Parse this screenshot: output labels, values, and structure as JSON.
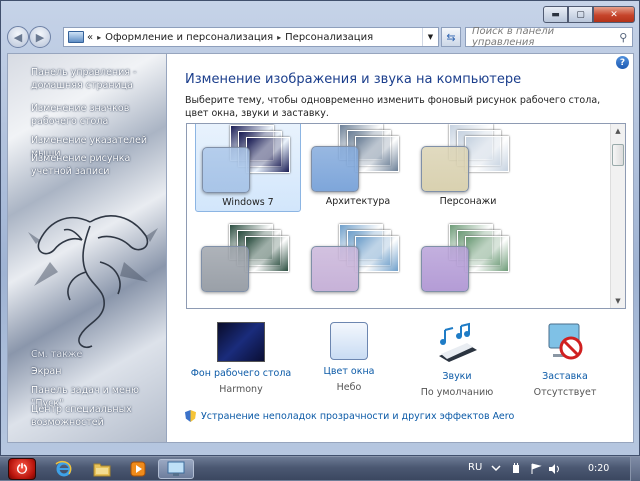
{
  "window": {
    "minimize": "▬",
    "maximize": "▢",
    "close": "✕"
  },
  "nav": {
    "back_icon": "arrow-left-icon",
    "forward_icon": "arrow-right-icon",
    "breadcrumb": [
      "Оформление и персонализация",
      "Персонализация"
    ],
    "breadcrumb_prefix": "«",
    "separator": "▸",
    "search_placeholder": "Поиск в панели управления"
  },
  "sidebar": {
    "home_link": "Панель управления - домашняя страница",
    "links": [
      "Изменение значков рабочего стола",
      "Изменение указателей мыши",
      "Изменение рисунка учетной записи"
    ],
    "see_also": "См. также",
    "see_also_links": [
      "Экран",
      "Панель задач и меню \"Пуск\"",
      "Центр специальных возможностей"
    ]
  },
  "main": {
    "title": "Изменение изображения и звука на компьютере",
    "description": "Выберите тему, чтобы одновременно изменить фоновый рисунок рабочего стола, цвет окна, звуки и заставку.",
    "themes": [
      {
        "name": "Windows 7",
        "selected": true,
        "bg": "#1a1d54",
        "swatch": "#a9c5e8"
      },
      {
        "name": "Архитектура",
        "selected": false,
        "bg": "#6b7f96",
        "swatch": "#7ea6da"
      },
      {
        "name": "Персонажи",
        "selected": false,
        "bg": "#c6d2e0",
        "swatch": "#d9d1b0"
      },
      {
        "name": "",
        "selected": false,
        "bg": "#2a4d3f",
        "swatch": "#9aa0a8"
      },
      {
        "name": "",
        "selected": false,
        "bg": "#6f9fca",
        "swatch": "#c7b2d8"
      },
      {
        "name": "",
        "selected": false,
        "bg": "#6d9b77",
        "swatch": "#b49cd6"
      }
    ],
    "settings": [
      {
        "link": "Фон рабочего стола",
        "value": "Harmony",
        "icon": "wallpaper-icon"
      },
      {
        "link": "Цвет окна",
        "value": "Небо",
        "icon": "window-color-icon"
      },
      {
        "link": "Звуки",
        "value": "По умолчанию",
        "icon": "sounds-icon"
      },
      {
        "link": "Заставка",
        "value": "Отсутствует",
        "icon": "screensaver-icon"
      }
    ],
    "aero_link": "Устранение неполадок прозрачности и других эффектов Aero"
  },
  "taskbar": {
    "language": "RU",
    "clock": "0:20"
  }
}
